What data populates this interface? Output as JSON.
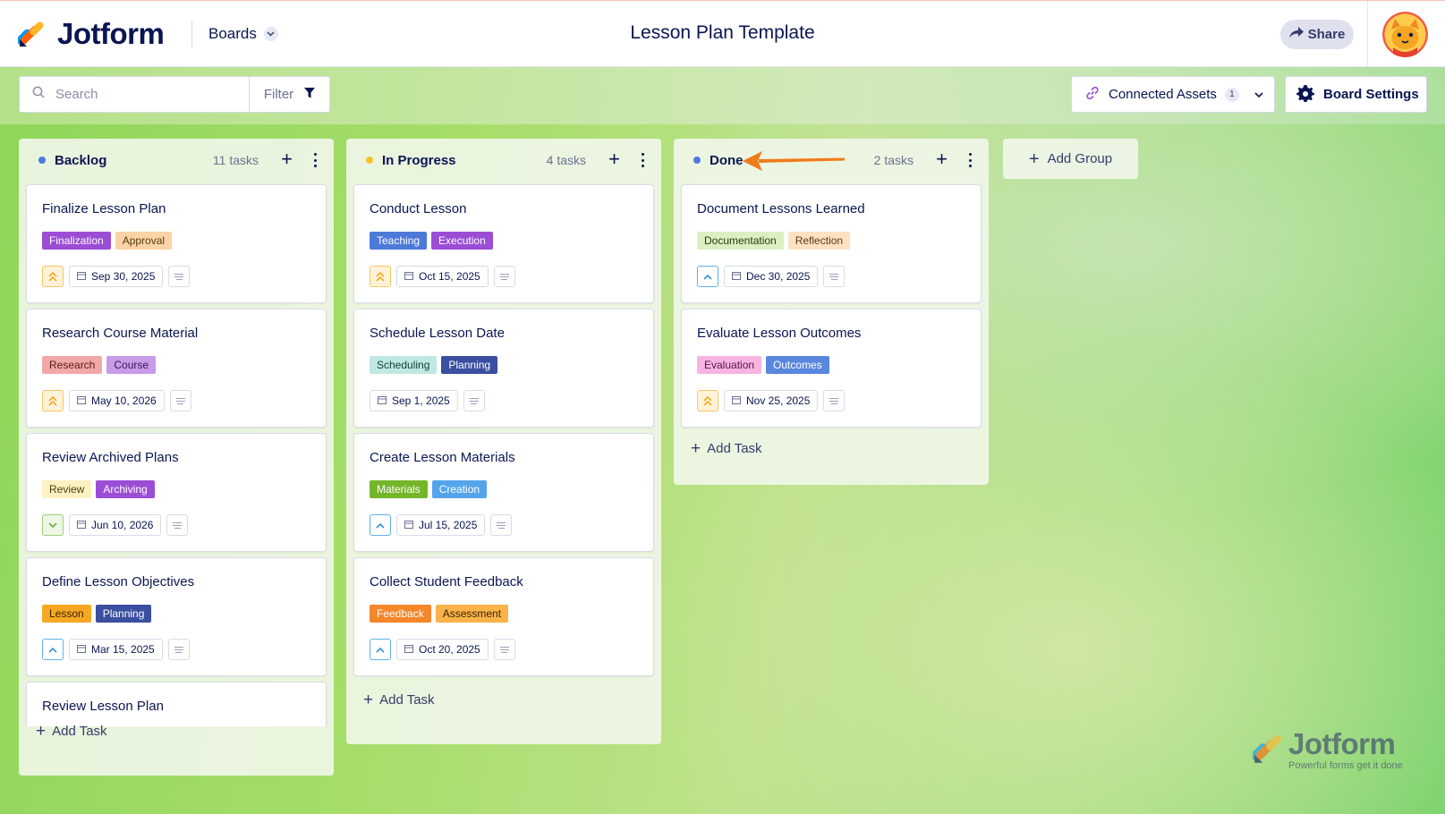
{
  "brand": {
    "name": "Jotform",
    "watermark_name": "Jotform",
    "watermark_tagline": "Powerful forms get it done"
  },
  "header": {
    "boards_label": "Boards",
    "title": "Lesson Plan Template",
    "share_label": "Share"
  },
  "toolbar": {
    "search_placeholder": "Search",
    "filter_label": "Filter",
    "connected_assets_label": "Connected Assets",
    "connected_assets_count": "1",
    "board_settings_label": "Board Settings"
  },
  "columns": [
    {
      "title": "Backlog",
      "count_label": "11 tasks",
      "dot_color": "#4c7ae0",
      "add_task_label": "Add Task",
      "cards": [
        {
          "title": "Finalize Lesson Plan",
          "priority": "high",
          "date": "Sep 30, 2025",
          "tags": [
            {
              "label": "Finalization",
              "bg": "#9b4dd6",
              "fg": "#ffffff"
            },
            {
              "label": "Approval",
              "bg": "#fbd3a6",
              "fg": "#5a3a12"
            }
          ]
        },
        {
          "title": "Research Course Material",
          "priority": "high",
          "date": "May 10, 2026",
          "tags": [
            {
              "label": "Research",
              "bg": "#f2a8a8",
              "fg": "#5a1a1a"
            },
            {
              "label": "Course",
              "bg": "#c79be8",
              "fg": "#3a1458"
            }
          ]
        },
        {
          "title": "Review Archived Plans",
          "priority": "low",
          "date": "Jun 10, 2026",
          "tags": [
            {
              "label": "Review",
              "bg": "#fdf2c2",
              "fg": "#4a3f10"
            },
            {
              "label": "Archiving",
              "bg": "#9b4dd6",
              "fg": "#ffffff"
            }
          ]
        },
        {
          "title": "Define Lesson Objectives",
          "priority": "medium",
          "date": "Mar 15, 2025",
          "tags": [
            {
              "label": "Lesson",
              "bg": "#f7a823",
              "fg": "#3a2400"
            },
            {
              "label": "Planning",
              "bg": "#3a4fa0",
              "fg": "#ffffff"
            }
          ]
        },
        {
          "title": "Review Lesson Plan"
        }
      ]
    },
    {
      "title": "In Progress",
      "count_label": "4 tasks",
      "dot_color": "#f2c530",
      "add_task_label": "Add Task",
      "cards": [
        {
          "title": "Conduct Lesson",
          "priority": "high",
          "date": "Oct 15, 2025",
          "tags": [
            {
              "label": "Teaching",
              "bg": "#4d7ad9",
              "fg": "#ffffff"
            },
            {
              "label": "Execution",
              "bg": "#9b4dd6",
              "fg": "#ffffff"
            }
          ]
        },
        {
          "title": "Schedule Lesson Date",
          "priority": "none",
          "date": "Sep 1, 2025",
          "tags": [
            {
              "label": "Scheduling",
              "bg": "#bfe8e2",
              "fg": "#0d3f3a"
            },
            {
              "label": "Planning",
              "bg": "#3a4fa0",
              "fg": "#ffffff"
            }
          ]
        },
        {
          "title": "Create Lesson Materials",
          "priority": "medium",
          "date": "Jul 15, 2025",
          "tags": [
            {
              "label": "Materials",
              "bg": "#74b62a",
              "fg": "#ffffff"
            },
            {
              "label": "Creation",
              "bg": "#54a4ec",
              "fg": "#ffffff"
            }
          ]
        },
        {
          "title": "Collect Student Feedback",
          "priority": "medium",
          "date": "Oct 20, 2025",
          "tags": [
            {
              "label": "Feedback",
              "bg": "#f5862a",
              "fg": "#ffffff"
            },
            {
              "label": "Assessment",
              "bg": "#f9b34a",
              "fg": "#3a2400"
            }
          ]
        }
      ]
    },
    {
      "title": "Done",
      "count_label": "2 tasks",
      "dot_color": "#4c7ae0",
      "add_task_label": "Add Task",
      "cards": [
        {
          "title": "Document Lessons Learned",
          "priority": "medium",
          "date": "Dec 30, 2025",
          "tags": [
            {
              "label": "Documentation",
              "bg": "#daf0c2",
              "fg": "#233b0d"
            },
            {
              "label": "Reflection",
              "bg": "#fde2c2",
              "fg": "#5a3a12"
            }
          ]
        },
        {
          "title": "Evaluate Lesson Outcomes",
          "priority": "high",
          "date": "Nov 25, 2025",
          "tags": [
            {
              "label": "Evaluation",
              "bg": "#f7b4e2",
              "fg": "#5a1444"
            },
            {
              "label": "Outcomes",
              "bg": "#5b86df",
              "fg": "#ffffff"
            }
          ]
        }
      ]
    }
  ],
  "add_group_label": "Add Group",
  "colors": {
    "annotation_arrow": "#f07b1a",
    "accent_navy": "#0a1551"
  }
}
